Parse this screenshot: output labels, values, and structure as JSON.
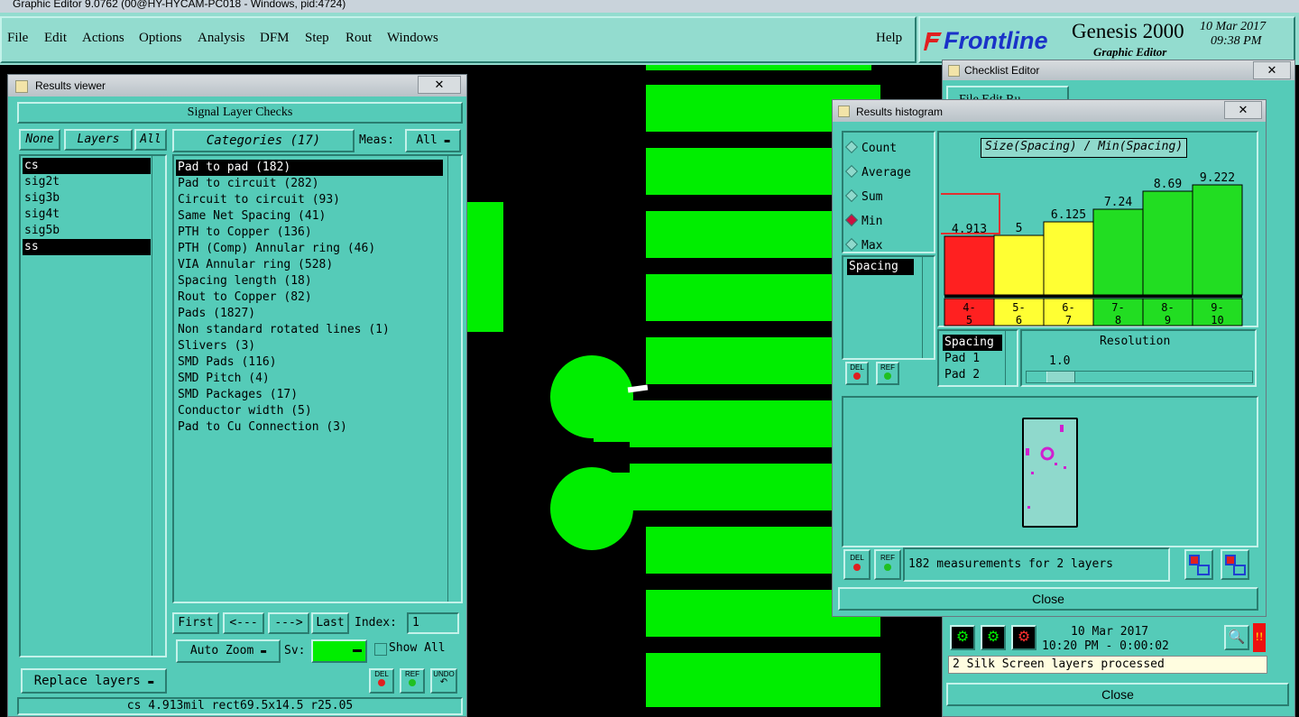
{
  "app": {
    "window_title": "Graphic Editor 9.0762 (00@HY-HYCAM-PC018 - Windows, pid:4724)",
    "menu": [
      "File",
      "Edit",
      "Actions",
      "Options",
      "Analysis",
      "DFM",
      "Step",
      "Rout",
      "Windows"
    ],
    "help": "Help",
    "brand": "Frontline",
    "product": "Genesis 2000",
    "product_sub": "Graphic Editor",
    "date": "10 Mar 2017",
    "time": "09:38 PM"
  },
  "results_viewer": {
    "title": "Results viewer",
    "header": "Signal Layer Checks",
    "none_btn": "None",
    "layers_label": "Layers",
    "all_btn": "All",
    "layers": [
      "cs",
      "sig2t",
      "sig3b",
      "sig4t",
      "sig5b",
      "ss"
    ],
    "categories_label": "Categories (17)",
    "meas_label": "Meas:",
    "meas_value": "All",
    "categories": [
      "Pad to pad (182)",
      "Pad to circuit (282)",
      "Circuit to circuit (93)",
      "Same Net Spacing (41)",
      "PTH to Copper (136)",
      "PTH (Comp) Annular ring (46)",
      "VIA Annular ring (528)",
      "Spacing length (18)",
      "Rout to Copper (82)",
      "Pads (1827)",
      "Non standard rotated lines (1)",
      "Slivers (3)",
      "SMD Pads (116)",
      "SMD Pitch (4)",
      "SMD Packages (17)",
      "Conductor width (5)",
      "Pad to Cu Connection (3)"
    ],
    "first": "First",
    "prev": "<---",
    "next": "--->",
    "last": "Last",
    "index_label": "Index:",
    "index_value": "1",
    "auto_zoom": "Auto Zoom",
    "sv_label": "Sv:",
    "show_all": "Show All",
    "replace_layers": "Replace layers",
    "del": "DEL",
    "ref": "REF",
    "undo": "UNDO",
    "status": "cs 4.913mil  rect69.5x14.5  r25.05"
  },
  "checklist_editor": {
    "title": "Checklist Editor",
    "menu_partial": "File  Edit  Ru",
    "date": "10 Mar 2017",
    "time": "10:20 PM - 0:00:02",
    "status": "2 Silk Screen layers processed",
    "close": "Close"
  },
  "histogram": {
    "title": "Results histogram",
    "options": [
      "Count",
      "Average",
      "Sum",
      "Min",
      "Max"
    ],
    "selected_option": "Min",
    "chart_title": "Size(Spacing) / Min(Spacing)",
    "field_list": [
      "Spacing"
    ],
    "bars": [
      {
        "value": "4.913",
        "range_top": "4-",
        "range_bot": "5",
        "color": "#ff2020"
      },
      {
        "value": "5",
        "range_top": "5-",
        "range_bot": "6",
        "color": "#ffff33"
      },
      {
        "value": "6.125",
        "range_top": "6-",
        "range_bot": "7",
        "color": "#ffff33"
      },
      {
        "value": "7.24",
        "range_top": "7-",
        "range_bot": "8",
        "color": "#22dd22"
      },
      {
        "value": "8.69",
        "range_top": "8-",
        "range_bot": "9",
        "color": "#22dd22"
      },
      {
        "value": "9.222",
        "range_top": "9-",
        "range_bot": "10",
        "color": "#22dd22"
      }
    ],
    "measure_list": [
      "Spacing",
      "Pad 1",
      "Pad 2"
    ],
    "resolution_label": "Resolution",
    "resolution_value": "1.0",
    "del": "DEL",
    "ref": "REF",
    "summary": "182 measurements for 2 layers",
    "close": "Close"
  }
}
